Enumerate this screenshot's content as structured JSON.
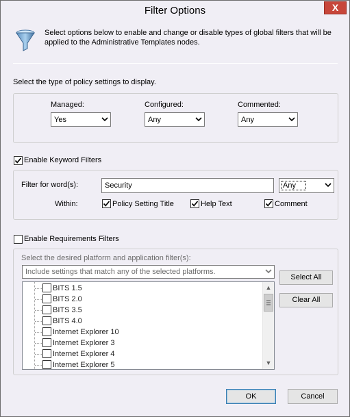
{
  "window": {
    "title": "Filter Options",
    "close_glyph": "X"
  },
  "header": {
    "description": "Select options below to enable and change or disable types of global filters that will be applied to the Administrative Templates nodes.",
    "icon": "funnel-icon"
  },
  "policy_type": {
    "prompt": "Select the type of policy settings to display.",
    "managed": {
      "label": "Managed:",
      "value": "Yes"
    },
    "configured": {
      "label": "Configured:",
      "value": "Any"
    },
    "commented": {
      "label": "Commented:",
      "value": "Any"
    }
  },
  "keyword": {
    "enable_label": "Enable Keyword Filters",
    "enabled": true,
    "filter_label": "Filter for word(s):",
    "filter_value": "Security",
    "match_value": "Any",
    "within_label": "Within:",
    "options": [
      {
        "label": "Policy Setting Title",
        "checked": true
      },
      {
        "label": "Help Text",
        "checked": true
      },
      {
        "label": "Comment",
        "checked": true
      }
    ]
  },
  "requirements": {
    "enable_label": "Enable Requirements Filters",
    "enabled": false,
    "prompt": "Select the desired platform and application filter(s):",
    "include_value": "Include settings that match any of the selected platforms.",
    "platforms": [
      "BITS 1.5",
      "BITS 2.0",
      "BITS 3.5",
      "BITS 4.0",
      "Internet Explorer 10",
      "Internet Explorer 3",
      "Internet Explorer 4",
      "Internet Explorer 5"
    ],
    "select_all_label": "Select All",
    "clear_all_label": "Clear All"
  },
  "footer": {
    "ok_label": "OK",
    "cancel_label": "Cancel"
  },
  "colors": {
    "accent": "#3c7fb1",
    "close": "#c7463a",
    "background": "#f0eef5"
  }
}
